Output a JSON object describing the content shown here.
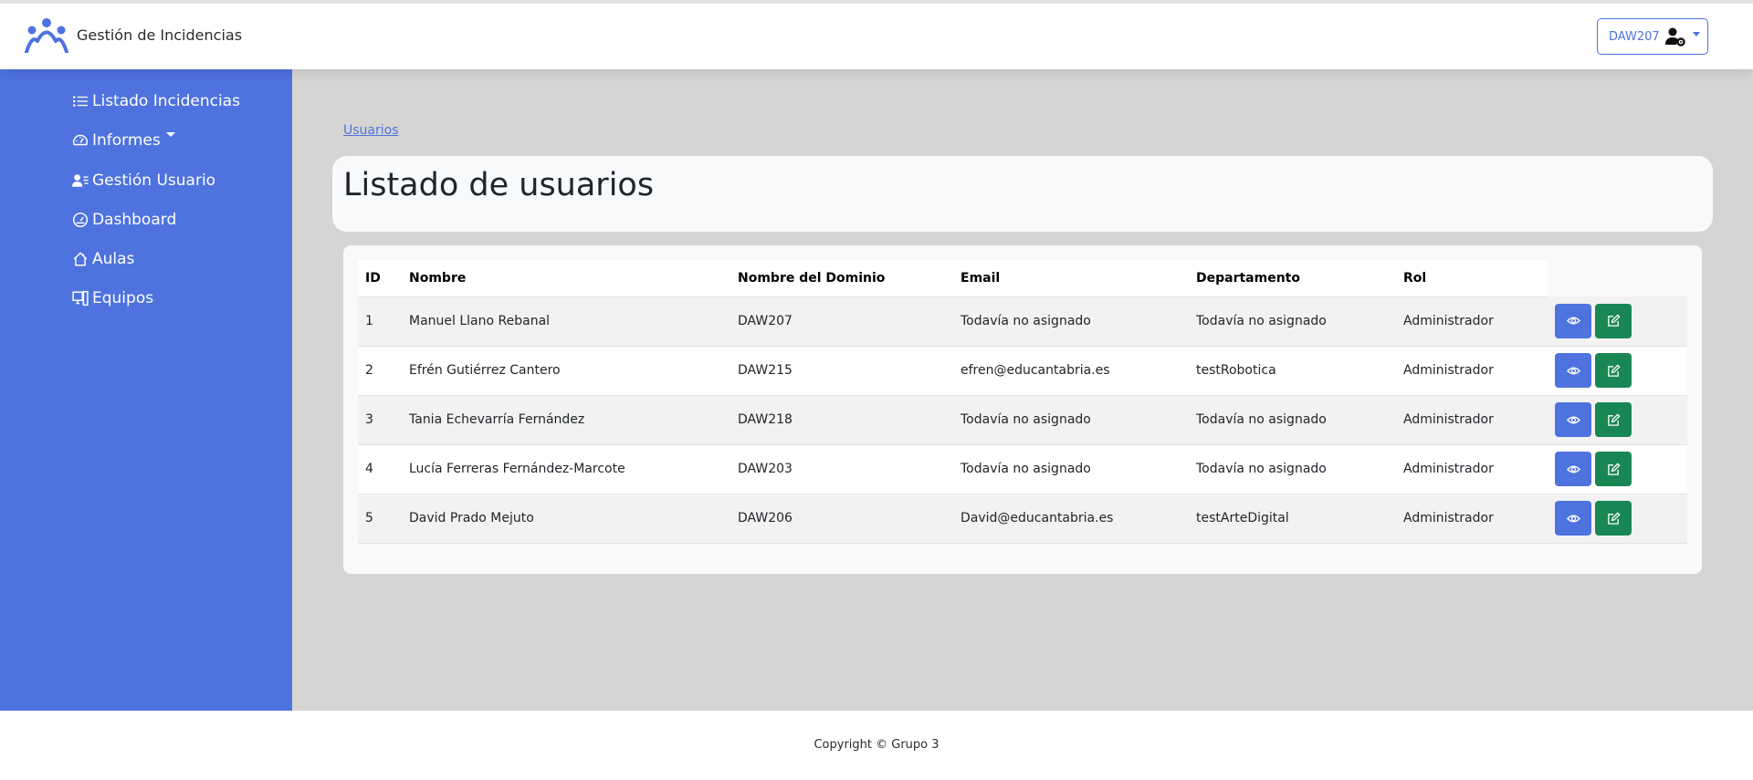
{
  "app": {
    "title": "Gestión de Incidencias"
  },
  "header": {
    "username": "DAW207"
  },
  "sidebar": {
    "items": [
      {
        "label": "Listado Incidencias",
        "icon": "list-icon"
      },
      {
        "label": "Informes",
        "icon": "speedometer-icon"
      },
      {
        "label": "Gestión Usuario",
        "icon": "person-lines-icon"
      },
      {
        "label": "Dashboard",
        "icon": "dashboard-gauge-icon"
      },
      {
        "label": "Aulas",
        "icon": "house-icon"
      },
      {
        "label": "Equipos",
        "icon": "pc-display-icon"
      }
    ]
  },
  "breadcrumb": {
    "link": "Usuarios"
  },
  "main": {
    "title": "Listado de usuarios"
  },
  "table": {
    "headers": [
      "ID",
      "Nombre",
      "Nombre del Dominio",
      "Email",
      "Departamento",
      "Rol"
    ],
    "rows": [
      [
        "1",
        "Manuel Llano Rebanal",
        "DAW207",
        "Todavía no asignado",
        "Todavía no asignado",
        "Administrador"
      ],
      [
        "2",
        "Efrén Gutiérrez Cantero",
        "DAW215",
        "efren@educantabria.es",
        "testRobotica",
        "Administrador"
      ],
      [
        "3",
        "Tania Echevarría Fernández",
        "DAW218",
        "Todavía no asignado",
        "Todavía no asignado",
        "Administrador"
      ],
      [
        "4",
        "Lucía Ferreras Fernández-Marcote",
        "DAW203",
        "Todavía no asignado",
        "Todavía no asignado",
        "Administrador"
      ],
      [
        "5",
        "David Prado Mejuto",
        "DAW206",
        "David@educantabria.es",
        "testArteDigital",
        "Administrador"
      ]
    ]
  },
  "footer": {
    "copyright": "Copyright © Grupo 3"
  },
  "colors": {
    "primary": "#4e73df",
    "success": "#198754",
    "background": "#d6d5d4"
  }
}
